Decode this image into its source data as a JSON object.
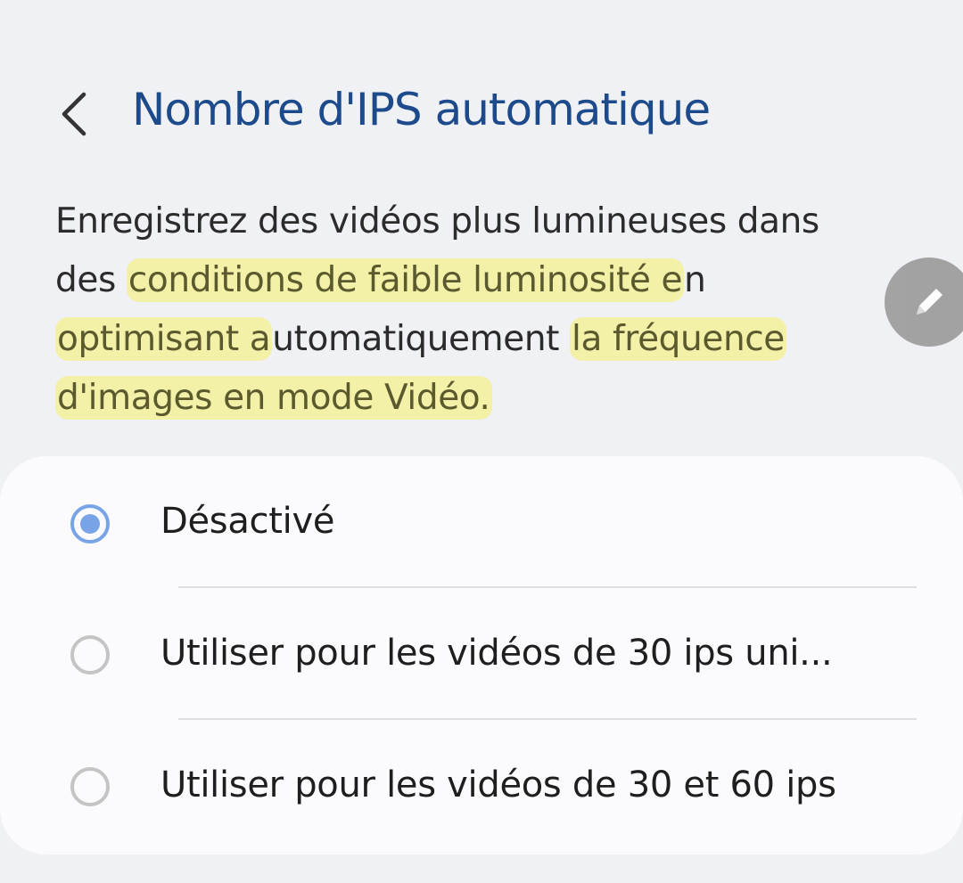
{
  "header": {
    "back_icon": "chevron-left-icon",
    "title": "Nombre d'IPS automatique"
  },
  "description": {
    "part1": "Enregistrez des vidéos plus lumineuses dans des ",
    "highlight1": "conditions de faible luminosité e",
    "part2": "n ",
    "highlight2": "optimisant a",
    "part3": "utomatiquement ",
    "highlight3": "la fréquence d'images en mode Vidéo."
  },
  "edit_button": {
    "icon": "pencil-icon"
  },
  "options": [
    {
      "label": "Désactivé",
      "selected": true
    },
    {
      "label": "Utiliser pour les vidéos de 30 ips uni...",
      "selected": false
    },
    {
      "label": "Utiliser pour les vidéos de 30 et 60 ips",
      "selected": false
    }
  ],
  "colors": {
    "title": "#1d4a8b",
    "highlight": "#f3f0a8",
    "radio_selected": "#78a3e6",
    "background": "#f0f1f5",
    "card": "#fbfbfd"
  }
}
